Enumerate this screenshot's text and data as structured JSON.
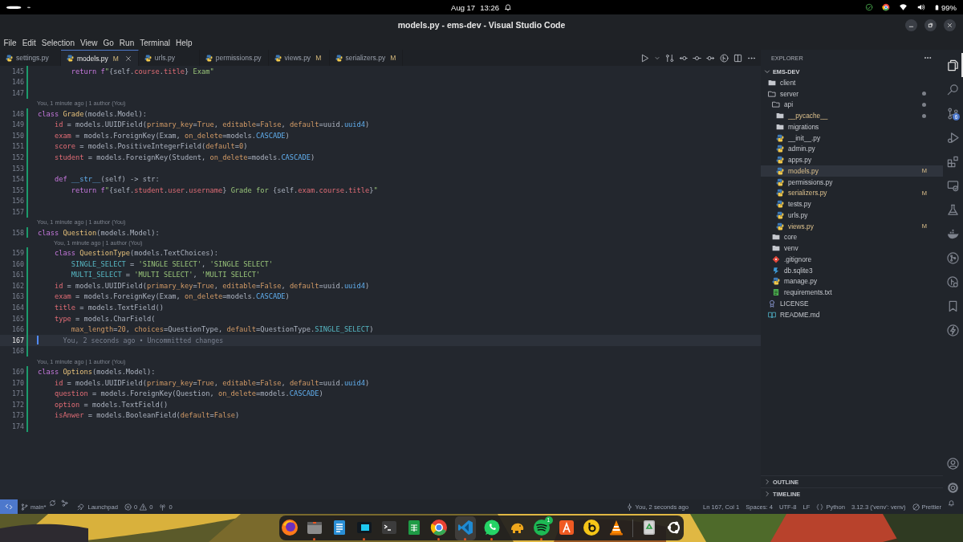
{
  "system_bar": {
    "date": "Aug 17",
    "time": "13:26",
    "battery": "99%"
  },
  "window": {
    "title": "models.py - ems-dev - Visual Studio Code"
  },
  "menu": [
    "File",
    "Edit",
    "Selection",
    "View",
    "Go",
    "Run",
    "Terminal",
    "Help"
  ],
  "tabs": [
    {
      "label": "settings.py",
      "selected": false
    },
    {
      "label": "models.py",
      "badge": "M",
      "selected": true
    },
    {
      "label": "urls.py",
      "selected": false
    },
    {
      "label": "permissions.py",
      "selected": false
    },
    {
      "label": "views.py",
      "badge": "M",
      "selected": false
    },
    {
      "label": "serializers.py",
      "badge": "M",
      "selected": false
    }
  ],
  "editor": {
    "lines": [
      {
        "kind": "code",
        "number": "145",
        "current": false,
        "added": true,
        "segments": [
          {
            "kind": "kw",
            "text": "        return f"
          },
          {
            "kind": "str",
            "text": "\""
          },
          {
            "kind": "pl",
            "text": "{self."
          },
          {
            "kind": "var",
            "text": "course"
          },
          {
            "kind": "pl",
            "text": "."
          },
          {
            "kind": "var",
            "text": "title"
          },
          {
            "kind": "pl",
            "text": "}"
          },
          {
            "kind": "str",
            "text": " Exam\""
          }
        ]
      },
      {
        "kind": "code",
        "number": "146",
        "current": false,
        "added": true
      },
      {
        "kind": "code",
        "number": "147",
        "current": false,
        "added": true
      },
      {
        "kind": "lens",
        "text": "You, 1 minute ago | 1 author (You)"
      },
      {
        "kind": "code",
        "number": "148",
        "current": false,
        "added": true,
        "segments": [
          {
            "kind": "kw",
            "text": "class "
          },
          {
            "kind": "cls",
            "text": "Grade"
          },
          {
            "kind": "pl",
            "text": "(models.Model):"
          }
        ]
      },
      {
        "kind": "code",
        "number": "149",
        "current": false,
        "added": true,
        "segments": [
          {
            "kind": "var",
            "text": "    id"
          },
          {
            "kind": "pl",
            "text": " = models.UUIDField("
          },
          {
            "kind": "prm",
            "text": "primary_key"
          },
          {
            "kind": "pl",
            "text": "="
          },
          {
            "kind": "prm",
            "text": "True"
          },
          {
            "kind": "pl",
            "text": ", "
          },
          {
            "kind": "prm",
            "text": "editable"
          },
          {
            "kind": "pl",
            "text": "="
          },
          {
            "kind": "prm",
            "text": "False"
          },
          {
            "kind": "pl",
            "text": ", "
          },
          {
            "kind": "prm",
            "text": "default"
          },
          {
            "kind": "pl",
            "text": "=uuid."
          },
          {
            "kind": "con",
            "text": "uuid4"
          },
          {
            "kind": "pl",
            "text": ")"
          }
        ]
      },
      {
        "kind": "code",
        "number": "150",
        "current": false,
        "added": true,
        "segments": [
          {
            "kind": "var",
            "text": "    exam"
          },
          {
            "kind": "pl",
            "text": " = models.ForeignKey(Exam, "
          },
          {
            "kind": "prm",
            "text": "on_delete"
          },
          {
            "kind": "pl",
            "text": "=models."
          },
          {
            "kind": "con",
            "text": "CASCADE"
          },
          {
            "kind": "pl",
            "text": ")"
          }
        ]
      },
      {
        "kind": "code",
        "number": "151",
        "current": false,
        "added": true,
        "segments": [
          {
            "kind": "var",
            "text": "    score"
          },
          {
            "kind": "pl",
            "text": " = models.PositiveIntegerField("
          },
          {
            "kind": "prm",
            "text": "default"
          },
          {
            "kind": "pl",
            "text": "="
          },
          {
            "kind": "num",
            "text": "0"
          },
          {
            "kind": "pl",
            "text": ")"
          }
        ]
      },
      {
        "kind": "code",
        "number": "152",
        "current": false,
        "added": true,
        "segments": [
          {
            "kind": "var",
            "text": "    student"
          },
          {
            "kind": "pl",
            "text": " = models.ForeignKey(Student, "
          },
          {
            "kind": "prm",
            "text": "on_delete"
          },
          {
            "kind": "pl",
            "text": "=models."
          },
          {
            "kind": "con",
            "text": "CASCADE"
          },
          {
            "kind": "pl",
            "text": ")"
          }
        ]
      },
      {
        "kind": "code",
        "number": "153",
        "current": false,
        "added": true
      },
      {
        "kind": "code",
        "number": "154",
        "current": false,
        "added": true,
        "segments": [
          {
            "kind": "kw",
            "text": "    def "
          },
          {
            "kind": "con",
            "text": "__str__"
          },
          {
            "kind": "pl",
            "text": "(self) -> str:"
          }
        ]
      },
      {
        "kind": "code",
        "number": "155",
        "current": false,
        "added": true,
        "segments": [
          {
            "kind": "kw",
            "text": "        return f"
          },
          {
            "kind": "str",
            "text": "\""
          },
          {
            "kind": "pl",
            "text": "{self."
          },
          {
            "kind": "var",
            "text": "student"
          },
          {
            "kind": "pl",
            "text": "."
          },
          {
            "kind": "var",
            "text": "user"
          },
          {
            "kind": "pl",
            "text": "."
          },
          {
            "kind": "var",
            "text": "username"
          },
          {
            "kind": "pl",
            "text": "}"
          },
          {
            "kind": "str",
            "text": " Grade for "
          },
          {
            "kind": "pl",
            "text": "{self."
          },
          {
            "kind": "var",
            "text": "exam"
          },
          {
            "kind": "pl",
            "text": "."
          },
          {
            "kind": "var",
            "text": "course"
          },
          {
            "kind": "pl",
            "text": "."
          },
          {
            "kind": "var",
            "text": "title"
          },
          {
            "kind": "pl",
            "text": "}"
          },
          {
            "kind": "str",
            "text": "\""
          }
        ]
      },
      {
        "kind": "code",
        "number": "156",
        "current": false,
        "added": true
      },
      {
        "kind": "code",
        "number": "157",
        "current": false,
        "added": true
      },
      {
        "kind": "lens",
        "text": "You, 1 minute ago | 1 author (You)"
      },
      {
        "kind": "code",
        "number": "158",
        "current": false,
        "added": true,
        "segments": [
          {
            "kind": "kw",
            "text": "class "
          },
          {
            "kind": "cls",
            "text": "Question"
          },
          {
            "kind": "pl",
            "text": "(models.Model):"
          }
        ]
      },
      {
        "kind": "lens",
        "text": "You, 1 minute ago | 1 author (You)"
      },
      {
        "kind": "code",
        "number": "159",
        "current": false,
        "added": true,
        "segments": [
          {
            "kind": "kw",
            "text": "    class "
          },
          {
            "kind": "cls",
            "text": "QuestionType"
          },
          {
            "kind": "pl",
            "text": "(models.TextChoices):"
          }
        ]
      },
      {
        "kind": "code",
        "number": "160",
        "current": false,
        "added": true,
        "segments": [
          {
            "kind": "cy",
            "text": "        SINGLE_SELECT"
          },
          {
            "kind": "pl",
            "text": " = "
          },
          {
            "kind": "str",
            "text": "'SINGLE SELECT'"
          },
          {
            "kind": "pl",
            "text": ", "
          },
          {
            "kind": "str",
            "text": "'SINGLE SELECT'"
          }
        ]
      },
      {
        "kind": "code",
        "number": "161",
        "current": false,
        "added": true,
        "segments": [
          {
            "kind": "cy",
            "text": "        MULTI_SELECT"
          },
          {
            "kind": "pl",
            "text": " = "
          },
          {
            "kind": "str",
            "text": "'MULTI SELECT'"
          },
          {
            "kind": "pl",
            "text": ", "
          },
          {
            "kind": "str",
            "text": "'MULTI SELECT'"
          }
        ]
      },
      {
        "kind": "code",
        "number": "162",
        "current": false,
        "added": true,
        "segments": [
          {
            "kind": "var",
            "text": "    id"
          },
          {
            "kind": "pl",
            "text": " = models.UUIDField("
          },
          {
            "kind": "prm",
            "text": "primary_key"
          },
          {
            "kind": "pl",
            "text": "="
          },
          {
            "kind": "prm",
            "text": "True"
          },
          {
            "kind": "pl",
            "text": ", "
          },
          {
            "kind": "prm",
            "text": "editable"
          },
          {
            "kind": "pl",
            "text": "="
          },
          {
            "kind": "prm",
            "text": "False"
          },
          {
            "kind": "pl",
            "text": ", "
          },
          {
            "kind": "prm",
            "text": "default"
          },
          {
            "kind": "pl",
            "text": "=uuid."
          },
          {
            "kind": "con",
            "text": "uuid4"
          },
          {
            "kind": "pl",
            "text": ")"
          }
        ]
      },
      {
        "kind": "code",
        "number": "163",
        "current": false,
        "added": true,
        "segments": [
          {
            "kind": "var",
            "text": "    exam"
          },
          {
            "kind": "pl",
            "text": " = models.ForeignKey(Exam, "
          },
          {
            "kind": "prm",
            "text": "on_delete"
          },
          {
            "kind": "pl",
            "text": "=models."
          },
          {
            "kind": "con",
            "text": "CASCADE"
          },
          {
            "kind": "pl",
            "text": ")"
          }
        ]
      },
      {
        "kind": "code",
        "number": "164",
        "current": false,
        "added": true,
        "segments": [
          {
            "kind": "var",
            "text": "    title"
          },
          {
            "kind": "pl",
            "text": " = models.TextField()"
          }
        ]
      },
      {
        "kind": "code",
        "number": "165",
        "current": false,
        "added": true,
        "segments": [
          {
            "kind": "var",
            "text": "    type"
          },
          {
            "kind": "pl",
            "text": " = models.CharField("
          }
        ]
      },
      {
        "kind": "code",
        "number": "166",
        "current": false,
        "added": true,
        "segments": [
          {
            "kind": "prm",
            "text": "        max_length"
          },
          {
            "kind": "pl",
            "text": "="
          },
          {
            "kind": "num",
            "text": "20"
          },
          {
            "kind": "pl",
            "text": ", "
          },
          {
            "kind": "prm",
            "text": "choices"
          },
          {
            "kind": "pl",
            "text": "=QuestionType, "
          },
          {
            "kind": "prm",
            "text": "default"
          },
          {
            "kind": "pl",
            "text": "=QuestionType."
          },
          {
            "kind": "cy",
            "text": "SINGLE_SELECT"
          },
          {
            "kind": "pl",
            "text": ")"
          }
        ]
      },
      {
        "kind": "code",
        "number": "167",
        "current": true,
        "added": true,
        "blame": "You, 2 seconds ago • Uncommitted changes"
      },
      {
        "kind": "code",
        "number": "168",
        "current": false,
        "added": true
      },
      {
        "kind": "lens",
        "text": "You, 1 minute ago | 1 author (You)"
      },
      {
        "kind": "code",
        "number": "169",
        "current": false,
        "added": true,
        "segments": [
          {
            "kind": "kw",
            "text": "class "
          },
          {
            "kind": "cls",
            "text": "Options"
          },
          {
            "kind": "pl",
            "text": "(models.Model):"
          }
        ]
      },
      {
        "kind": "code",
        "number": "170",
        "current": false,
        "added": true,
        "segments": [
          {
            "kind": "var",
            "text": "    id"
          },
          {
            "kind": "pl",
            "text": " = models.UUIDField("
          },
          {
            "kind": "prm",
            "text": "primary_key"
          },
          {
            "kind": "pl",
            "text": "="
          },
          {
            "kind": "prm",
            "text": "True"
          },
          {
            "kind": "pl",
            "text": ", "
          },
          {
            "kind": "prm",
            "text": "editable"
          },
          {
            "kind": "pl",
            "text": "="
          },
          {
            "kind": "prm",
            "text": "False"
          },
          {
            "kind": "pl",
            "text": ", "
          },
          {
            "kind": "prm",
            "text": "default"
          },
          {
            "kind": "pl",
            "text": "=uuid."
          },
          {
            "kind": "con",
            "text": "uuid4"
          },
          {
            "kind": "pl",
            "text": ")"
          }
        ]
      },
      {
        "kind": "code",
        "number": "171",
        "current": false,
        "added": true,
        "segments": [
          {
            "kind": "var",
            "text": "    question"
          },
          {
            "kind": "pl",
            "text": " = models.ForeignKey(Question, "
          },
          {
            "kind": "prm",
            "text": "on_delete"
          },
          {
            "kind": "pl",
            "text": "=models."
          },
          {
            "kind": "con",
            "text": "CASCADE"
          },
          {
            "kind": "pl",
            "text": ")"
          }
        ]
      },
      {
        "kind": "code",
        "number": "172",
        "current": false,
        "added": true,
        "segments": [
          {
            "kind": "var",
            "text": "    option"
          },
          {
            "kind": "pl",
            "text": " = models.TextField()"
          }
        ]
      },
      {
        "kind": "code",
        "number": "173",
        "current": false,
        "added": true,
        "segments": [
          {
            "kind": "var",
            "text": "    isAnwer"
          },
          {
            "kind": "pl",
            "text": " = models.BooleanField("
          },
          {
            "kind": "prm",
            "text": "default"
          },
          {
            "kind": "pl",
            "text": "="
          },
          {
            "kind": "prm",
            "text": "False"
          },
          {
            "kind": "pl",
            "text": ")"
          }
        ]
      },
      {
        "kind": "code",
        "number": "174",
        "current": false,
        "added": true
      }
    ]
  },
  "explorer": {
    "title": "EXPLORER",
    "root": "EMS-DEV",
    "items": [
      {
        "label": "client",
        "kind": "folder",
        "expanded": false,
        "selected": false,
        "modified": false,
        "dot": false
      },
      {
        "label": "server",
        "kind": "folder",
        "expanded": true,
        "selected": false,
        "modified": false,
        "dot": true,
        "children": [
          {
            "label": "api",
            "kind": "folder",
            "expanded": true,
            "selected": false,
            "modified": false,
            "dot": true,
            "children": [
              {
                "label": "__pycache__",
                "kind": "folder",
                "expanded": false,
                "selected": false,
                "modified": true,
                "dot": true
              },
              {
                "label": "migrations",
                "kind": "folder",
                "expanded": false,
                "selected": false,
                "modified": false,
                "dot": false
              },
              {
                "label": "__init__.py",
                "kind": "python",
                "selected": false,
                "modified": false,
                "dot": false
              },
              {
                "label": "admin.py",
                "kind": "python",
                "selected": false,
                "modified": false,
                "dot": false
              },
              {
                "label": "apps.py",
                "kind": "python",
                "selected": false,
                "modified": false,
                "dot": false
              },
              {
                "label": "models.py",
                "kind": "python",
                "selected": true,
                "modified": true,
                "dot": false,
                "badge": "M"
              },
              {
                "label": "permissions.py",
                "kind": "python",
                "selected": false,
                "modified": false,
                "dot": false
              },
              {
                "label": "serializers.py",
                "kind": "python",
                "selected": false,
                "modified": true,
                "dot": false,
                "badge": "M"
              },
              {
                "label": "tests.py",
                "kind": "python",
                "selected": false,
                "modified": false,
                "dot": false
              },
              {
                "label": "urls.py",
                "kind": "python",
                "selected": false,
                "modified": false,
                "dot": false
              },
              {
                "label": "views.py",
                "kind": "python",
                "selected": false,
                "modified": true,
                "dot": false,
                "badge": "M"
              }
            ]
          },
          {
            "label": "core",
            "kind": "folder",
            "expanded": false,
            "selected": false,
            "modified": false,
            "dot": false
          },
          {
            "label": "venv",
            "kind": "folder",
            "expanded": false,
            "selected": false,
            "modified": false,
            "dot": false
          },
          {
            "label": ".gitignore",
            "kind": "git",
            "selected": false,
            "modified": false,
            "dot": false
          },
          {
            "label": "db.sqlite3",
            "kind": "database",
            "selected": false,
            "modified": false,
            "dot": false
          },
          {
            "label": "manage.py",
            "kind": "python",
            "selected": false,
            "modified": false,
            "dot": false
          },
          {
            "label": "requirements.txt",
            "kind": "text",
            "selected": false,
            "modified": false,
            "dot": false
          }
        ]
      },
      {
        "label": "LICENSE",
        "kind": "license",
        "selected": false,
        "modified": false,
        "dot": false
      },
      {
        "label": "README.md",
        "kind": "markdown",
        "selected": false,
        "modified": false,
        "dot": false
      }
    ],
    "sections": [
      "OUTLINE",
      "TIMELINE"
    ]
  },
  "activity_bar": {
    "top": [
      {
        "kind": "files",
        "selected": true
      },
      {
        "kind": "search",
        "selected": false
      },
      {
        "kind": "source-control",
        "selected": false,
        "badge": "6"
      },
      {
        "kind": "run",
        "selected": false
      },
      {
        "kind": "extensions",
        "selected": false
      },
      {
        "kind": "remote",
        "selected": false
      },
      {
        "kind": "testing",
        "selected": false
      },
      {
        "kind": "docker",
        "selected": false
      },
      {
        "kind": "gitlens",
        "selected": false
      },
      {
        "kind": "gitlens-inspect",
        "selected": false
      },
      {
        "kind": "bookmarks",
        "selected": false
      },
      {
        "kind": "lightning",
        "selected": false
      }
    ],
    "bottom": [
      {
        "kind": "account",
        "selected": false
      },
      {
        "kind": "settings",
        "selected": false
      }
    ]
  },
  "status_bar": {
    "branch": "main*",
    "launchpad": "Launchpad",
    "errors": "0",
    "warnings": "0",
    "ports": "0",
    "blame": "You, 2 seconds ago",
    "cursor": "Ln 167, Col 1",
    "indentation": "Spaces: 4",
    "encoding": "UTF-8",
    "eol": "LF",
    "language": "Python",
    "interpreter": "3.12.3 ('venv': venv)",
    "formatter": "Prettier"
  },
  "dock": [
    {
      "kind": "firefox",
      "running": false
    },
    {
      "kind": "files",
      "running": true
    },
    {
      "kind": "document",
      "running": false
    },
    {
      "kind": "window",
      "running": true
    },
    {
      "kind": "terminal",
      "running": false
    },
    {
      "kind": "spreadsheet",
      "running": false
    },
    {
      "kind": "chrome",
      "running": true
    },
    {
      "kind": "code",
      "running": true
    },
    {
      "kind": "chat",
      "running": true
    },
    {
      "kind": "elephant",
      "running": false
    },
    {
      "kind": "music",
      "running": true,
      "badge": "1"
    },
    {
      "kind": "store",
      "running": false
    },
    {
      "kind": "letter",
      "running": false
    },
    {
      "kind": "cone",
      "running": false
    },
    {
      "kind": "separator"
    },
    {
      "kind": "trash",
      "running": false
    },
    {
      "kind": "apps",
      "running": false
    }
  ]
}
